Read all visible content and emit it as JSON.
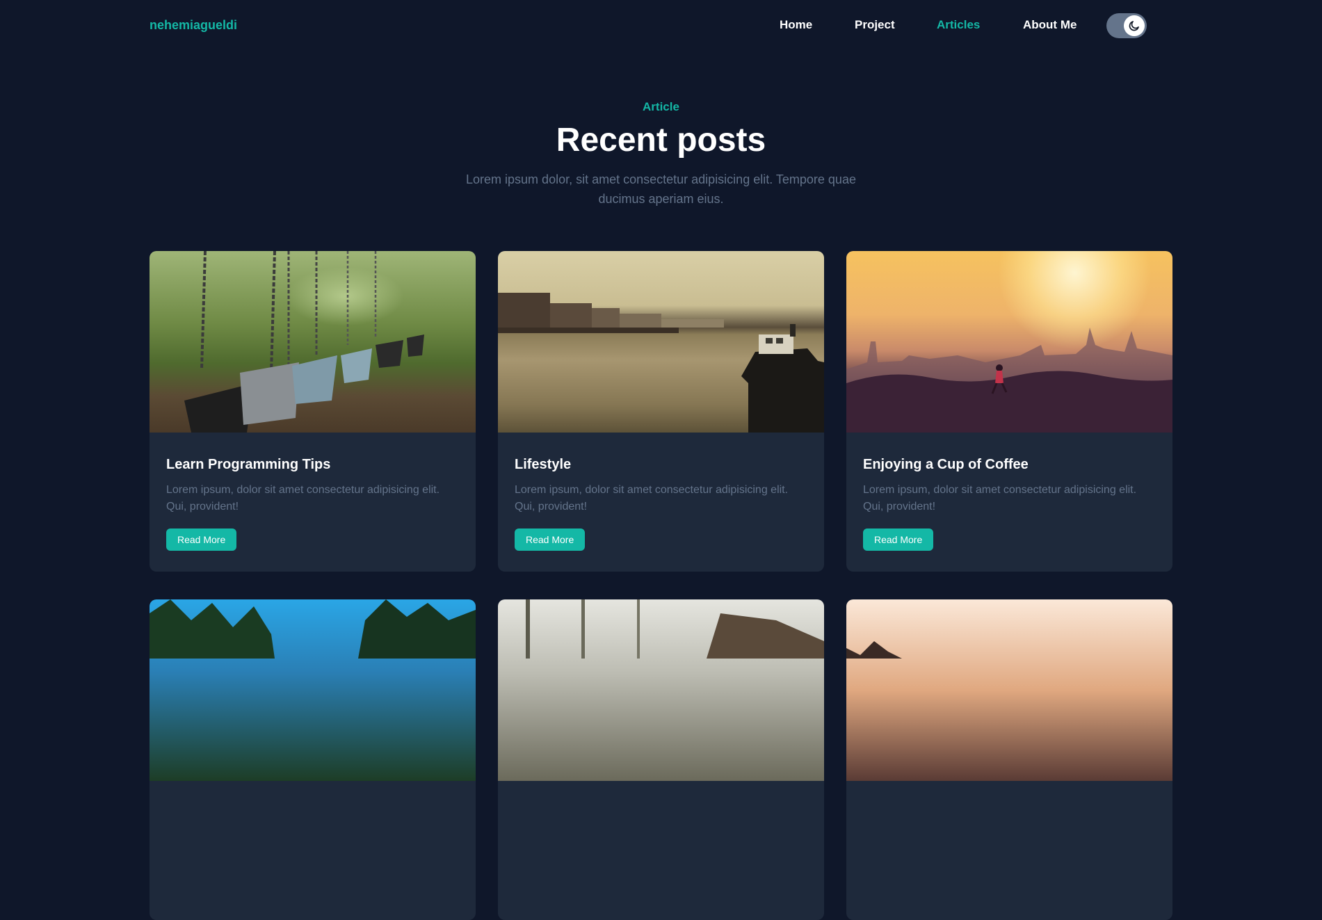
{
  "nav": {
    "brand": "nehemiagueldi",
    "links": [
      {
        "label": "Home",
        "active": false
      },
      {
        "label": "Project",
        "active": false
      },
      {
        "label": "Articles",
        "active": true
      },
      {
        "label": "About Me",
        "active": false
      }
    ],
    "theme_toggle_icon": "moon-icon"
  },
  "header": {
    "eyebrow": "Article",
    "title": "Recent posts",
    "subtitle": "Lorem ipsum dolor, sit amet consectetur adipisicing elit. Tempore quae ducimus aperiam eius."
  },
  "posts": [
    {
      "title": "Learn Programming Tips",
      "excerpt": "Lorem ipsum, dolor sit amet consectetur adipisicing elit. Qui, provident!",
      "button": "Read More",
      "image": "playground-swings-photo"
    },
    {
      "title": "Lifestyle",
      "excerpt": "Lorem ipsum, dolor sit amet consectetur adipisicing elit. Qui, provident!",
      "button": "Read More",
      "image": "river-city-boat-photo"
    },
    {
      "title": "Enjoying a Cup of Coffee",
      "excerpt": "Lorem ipsum, dolor sit amet consectetur adipisicing elit. Qui, provident!",
      "button": "Read More",
      "image": "sunset-runner-city-photo"
    },
    {
      "image": "forest-road-photo"
    },
    {
      "image": "woodland-path-photo"
    },
    {
      "image": "rocky-sunset-photo"
    }
  ],
  "colors": {
    "background": "#0f172a",
    "card": "#1e293b",
    "accent": "#14b8a6",
    "muted_text": "#64748b",
    "toggle": "#64748b"
  }
}
